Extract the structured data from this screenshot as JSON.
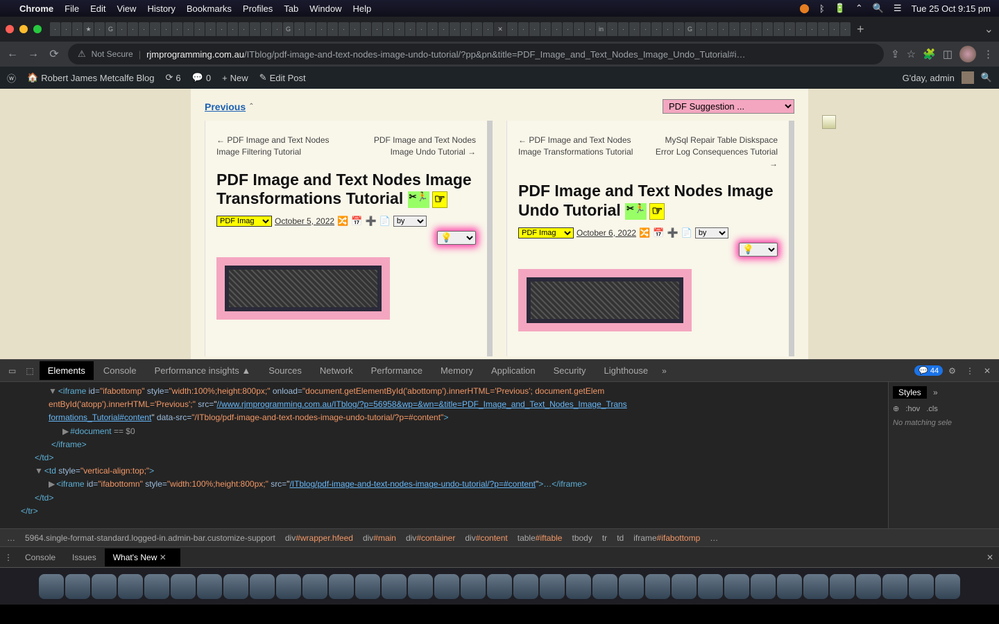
{
  "menubar": {
    "app": "Chrome",
    "items": [
      "File",
      "Edit",
      "View",
      "History",
      "Bookmarks",
      "Profiles",
      "Tab",
      "Window",
      "Help"
    ],
    "clock": "Tue 25 Oct  9:15 pm"
  },
  "browser": {
    "not_secure": "Not Secure",
    "url_host": "rjmprogramming.com.au",
    "url_path": "/ITblog/pdf-image-and-text-nodes-image-undo-tutorial/?pp&pn&title=PDF_Image_and_Text_Nodes_Image_Undo_Tutorial#i…"
  },
  "wpbar": {
    "site": "Robert James Metcalfe Blog",
    "updates": "6",
    "comments": "0",
    "new": "New",
    "edit": "Edit Post",
    "greeting": "G'day, admin"
  },
  "page": {
    "previous": "Previous",
    "pdf_suggestion": "PDF Suggestion ...",
    "col1": {
      "nav_prev": "← PDF Image and Text Nodes Image Filtering Tutorial",
      "nav_next": "PDF Image and Text Nodes Image Undo Tutorial →",
      "title": "PDF Image and Text Nodes Image Transformations Tutorial",
      "sel": "PDF Imag",
      "date": "October 5, 2022",
      "by": "by"
    },
    "col2": {
      "nav_prev": "← PDF Image and Text Nodes Image Transformations Tutorial",
      "nav_next": "MySql Repair Table Diskspace Error Log Consequences Tutorial →",
      "title": "PDF Image and Text Nodes Image Undo Tutorial",
      "sel": "PDF Imag",
      "date": "October 6, 2022",
      "by": "by"
    }
  },
  "devtools": {
    "tabs": [
      "Elements",
      "Console",
      "Performance insights",
      "Sources",
      "Network",
      "Performance",
      "Memory",
      "Application",
      "Security",
      "Lighthouse"
    ],
    "issues": "44",
    "dom": {
      "l1_open": "<iframe",
      "l1_id_attr": "id=",
      "l1_id_val": "\"ifabottomp\"",
      "l1_style_attr": "style=",
      "l1_style_val": "\"width:100%;height:800px;\"",
      "l1_onload_attr": "onload=",
      "l1_onload_val": "\"document.getElementById('abottomp').innerHTML='Previous'; document.getElem",
      "l1b": "entById('atopp').innerHTML='Previous';\"",
      "l1_src_attr": "src=",
      "l1_src_val": "//www.rjmprogramming.com.au/ITblog/?p=56958&wp=&wn=&title=PDF_Image_and_Text_Nodes_Image_Trans",
      "l1c": "formations_Tutorial#content",
      "l1_ds_attr": "data-src=",
      "l1_ds_val": "\"/ITblog/pdf-image-and-text-nodes-image-undo-tutorial/?p=#content\"",
      "l1_close": ">",
      "doc": "#document",
      "doc_eq": "== $0",
      "iframe_close": "</iframe>",
      "td_close": "</td>",
      "td_open": "<td",
      "td_style": "\"vertical-align:top;\"",
      "l2_id_val": "\"ifabottomn\"",
      "l2_src_val": "/ITblog/pdf-image-and-text-nodes-image-undo-tutorial/?p=#content",
      "l2_end": ">…</iframe>",
      "tr_close": "</tr>"
    },
    "breadcrumb": {
      "b0": "…",
      "b1a": "5964.single-format-standard.logged-in.admin-bar.customize-support",
      "b2": "div",
      "b2id": "#wrapper.hfeed",
      "b3": "div",
      "b3id": "#main",
      "b4": "div",
      "b4id": "#container",
      "b5": "div",
      "b5id": "#content",
      "b6": "table",
      "b6id": "#iftable",
      "b7": "tbody",
      "b8": "tr",
      "b9": "td",
      "b10": "iframe",
      "b10id": "#ifabottomp",
      "b11": "…"
    },
    "styles": {
      "tab": "Styles",
      "hov": ":hov",
      "cls": ".cls",
      "nomatch": "No matching sele"
    },
    "drawer": {
      "console": "Console",
      "issues": "Issues",
      "whatsnew": "What's New"
    }
  }
}
